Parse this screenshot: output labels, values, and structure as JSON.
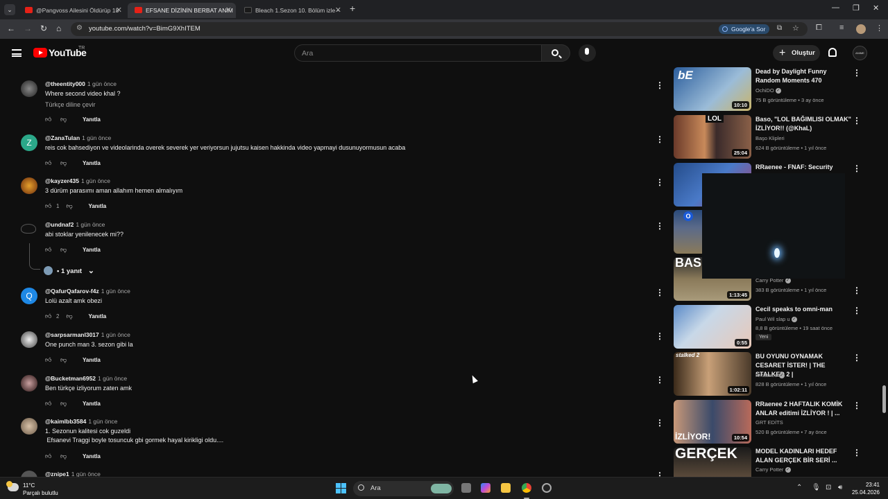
{
  "browser": {
    "tabs": [
      {
        "title": "@Pangvoss Ailesini Öldürüp 18"
      },
      {
        "title": "EFSANE DİZİNİN BERBAT ANİM"
      },
      {
        "title": "Bleach 1.Sezon 10. Bölüm izle -"
      }
    ],
    "url": "youtube.com/watch?v=BimG9XhITEM",
    "google_button": "Google'a Sor"
  },
  "youtube": {
    "logo_text": "YouTube",
    "country": "TR",
    "search_placeholder": "Ara",
    "create_label": "Oluştur",
    "user_avatar_text": "ANIME"
  },
  "comments": [
    {
      "user": "@theentity000",
      "time": "1 gün önce",
      "text": "Where second video khal ?",
      "translate": "Türkçe diline çevir",
      "likes": "",
      "reply": "Yanıtla"
    },
    {
      "user": "@ZanaTulan",
      "time": "1 gün önce",
      "text": "reis cok bahsediyon ve videolarinda overek severek yer veriyorsun jujutsu kaisen hakkinda video yapmayi dusunuyormusun acaba",
      "likes": "",
      "reply": "Yanıtla",
      "avatar_letter": "Z"
    },
    {
      "user": "@kayzer435",
      "time": "1 gün önce",
      "text": "3 dürüm parasımı aman allahım hemen almalıyım",
      "likes": "1",
      "reply": "Yanıtla"
    },
    {
      "user": "@undnaf2",
      "time": "1 gün önce",
      "text": "abi stoklar yenilenecek mi??",
      "likes": "",
      "reply": "Yanıtla",
      "replies_label": "1 yanıt"
    },
    {
      "user": "@QafurQafarov-f4z",
      "time": "1 gün önce",
      "text": "Lolü azalt amk obezi",
      "likes": "2",
      "reply": "Yanıtla",
      "avatar_letter": "Q"
    },
    {
      "user": "@sarpsarmanl3017",
      "time": "1 gün önce",
      "text": "One punch man 3. sezon gibi la",
      "likes": "",
      "reply": "Yanıtla"
    },
    {
      "user": "@Bucketman6952",
      "time": "1 gün önce",
      "text": "Ben türkçe izliyorum zaten amk",
      "likes": "",
      "reply": "Yanıtla"
    },
    {
      "user": "@kaimlbb3584",
      "time": "1 gün önce",
      "text": "1. Sezonun kalitesi cok guzeldi\n Efsanevi Traggi boyle tosuncuk gbi gormek hayal kirikligi oldu....",
      "likes": "",
      "reply": "Yanıtla"
    },
    {
      "user": "@znipe1",
      "time": "1 gün önce",
      "text": "",
      "likes": "",
      "reply": ""
    }
  ],
  "recommendations": [
    {
      "title": "Dead by Daylight Funny Random Moments 470",
      "channel": "OchiDO",
      "meta": "75 B görüntüleme • 3 ay önce",
      "duration": "10:10",
      "verified": true
    },
    {
      "title": "Baso, \"LOL BAĞIMLISI OLMAK\" İZLİYOR!! (@KhaL)",
      "channel": "Başo Klipleri",
      "meta": "624 B görüntüleme • 1 yıl önce",
      "duration": "25:04",
      "verified": false
    },
    {
      "title": "RRaenee - FNAF: Security",
      "channel": "",
      "meta": "",
      "duration": "",
      "verified": false
    },
    {
      "title": "",
      "channel": "Carry Potter",
      "meta": "383 B görüntüleme • 1 yıl önce",
      "duration": "1:13:45",
      "verified": true
    },
    {
      "title": "Cecil speaks to omni-man",
      "channel": "Paul Wil slap u",
      "meta": "8,8 B görüntüleme • 19 saat önce",
      "duration": "0:55",
      "verified": true,
      "badge": "Yeni"
    },
    {
      "title": "BU OYUNU OYNAMAK CESARET İSTER! | THE STALKED 2 |",
      "channel": "RRaenee",
      "meta": "828 B görüntüleme • 1 yıl önce",
      "duration": "1:02:11",
      "verified": true
    },
    {
      "title": "RRaenee 2 HAFTALIK KOMİK ANLAR editimi İZLİYOR ! | ...",
      "channel": "GRT EDİTS",
      "meta": "520 B görüntüleme • 7 ay önce",
      "duration": "10:54",
      "verified": false
    },
    {
      "title": "MODEL KADINLARI HEDEF ALAN GERÇEK BİR SERİ ...",
      "channel": "Carry Potter",
      "meta": "",
      "duration": "",
      "verified": true
    }
  ],
  "thumb_texts": [
    "bE",
    "LOL",
    "O",
    "BAS",
    "stalked 2",
    "İZLİYOR!",
    "GERÇEK"
  ],
  "taskbar": {
    "temp": "11°C",
    "weather": "Parçalı bulutlu",
    "search": "Ara",
    "time": "23:41",
    "date": "25.04.2026"
  }
}
